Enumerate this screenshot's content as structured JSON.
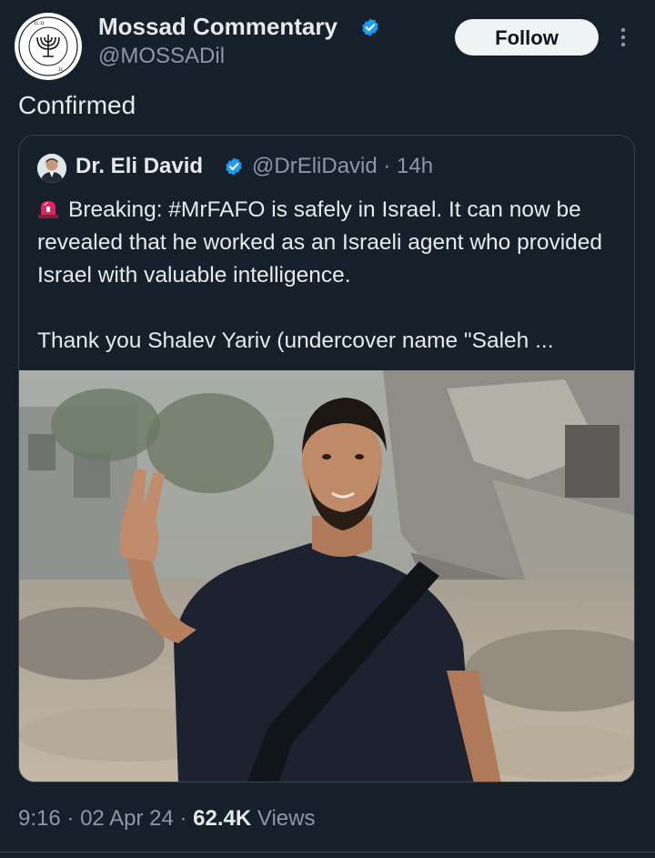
{
  "author": {
    "display_name": "Mossad Commentary",
    "handle": "@MOSSADil",
    "verified": true,
    "avatar_icon": "menorah-emblem-icon",
    "avatar_text": "אין זהב חמוד יותר מזהב"
  },
  "actions": {
    "follow_label": "Follow",
    "more_icon": "more-vertical-icon"
  },
  "post": {
    "text": "Confirmed"
  },
  "quoted_post": {
    "author_name": "Dr. Eli David",
    "verified": true,
    "handle_time": "@DrEliDavid · 14h",
    "emoji_icon": "police-siren-icon",
    "paragraph1": "Breaking: #MrFAFO is safely in Israel. It can now be revealed that he worked as an Israeli agent who provided Israel with valuable intelligence.",
    "paragraph2": "Thank you Shalev Yariv (undercover name \"Saleh ..."
  },
  "meta": {
    "time": "9:16",
    "date": "02 Apr 24",
    "separator": "·",
    "views_count": "62.4K",
    "views_label": "Views"
  },
  "colors": {
    "background": "#15202b",
    "text_primary": "#e7e9ea",
    "text_secondary": "#8b98a5",
    "verified_blue": "#1d9bf0",
    "border": "#38444d"
  }
}
